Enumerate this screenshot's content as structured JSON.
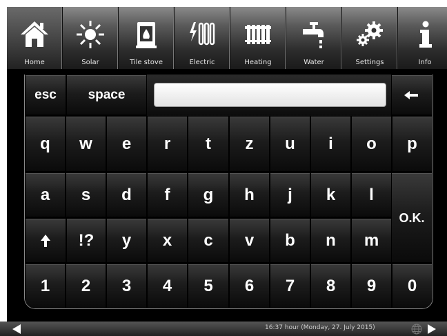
{
  "nav": {
    "items": [
      {
        "label": "Home",
        "icon": "home-icon"
      },
      {
        "label": "Solar",
        "icon": "sun-icon"
      },
      {
        "label": "Tile stove",
        "icon": "stove-icon"
      },
      {
        "label": "Electric",
        "icon": "electric-heater-icon"
      },
      {
        "label": "Heating",
        "icon": "radiator-icon"
      },
      {
        "label": "Water",
        "icon": "faucet-icon"
      },
      {
        "label": "Settings",
        "icon": "gears-icon"
      },
      {
        "label": "Info",
        "icon": "info-icon"
      }
    ]
  },
  "keyboard": {
    "esc": "esc",
    "space": "space",
    "text_value": "",
    "backspace_icon": "backspace-arrow-icon",
    "row1": [
      "q",
      "w",
      "e",
      "r",
      "t",
      "z",
      "u",
      "i",
      "o",
      "p"
    ],
    "row2": [
      "a",
      "s",
      "d",
      "f",
      "g",
      "h",
      "j",
      "k",
      "l"
    ],
    "row3": [
      "y",
      "x",
      "c",
      "v",
      "b",
      "n",
      "m"
    ],
    "symbols": "!?",
    "shift_icon": "shift-arrow-icon",
    "ok": "O.K.",
    "row4": [
      "1",
      "2",
      "3",
      "4",
      "5",
      "6",
      "7",
      "8",
      "9",
      "0"
    ]
  },
  "status": {
    "clock": "16:37 hour (Monday, 27. July 2015)",
    "left_icon": "page-left-icon",
    "right_icon": "page-right-icon",
    "globe_icon": "globe-icon"
  },
  "colors": {
    "background": "#000000",
    "key_text": "#ffffff",
    "nav_label": "#e8e8e8"
  }
}
